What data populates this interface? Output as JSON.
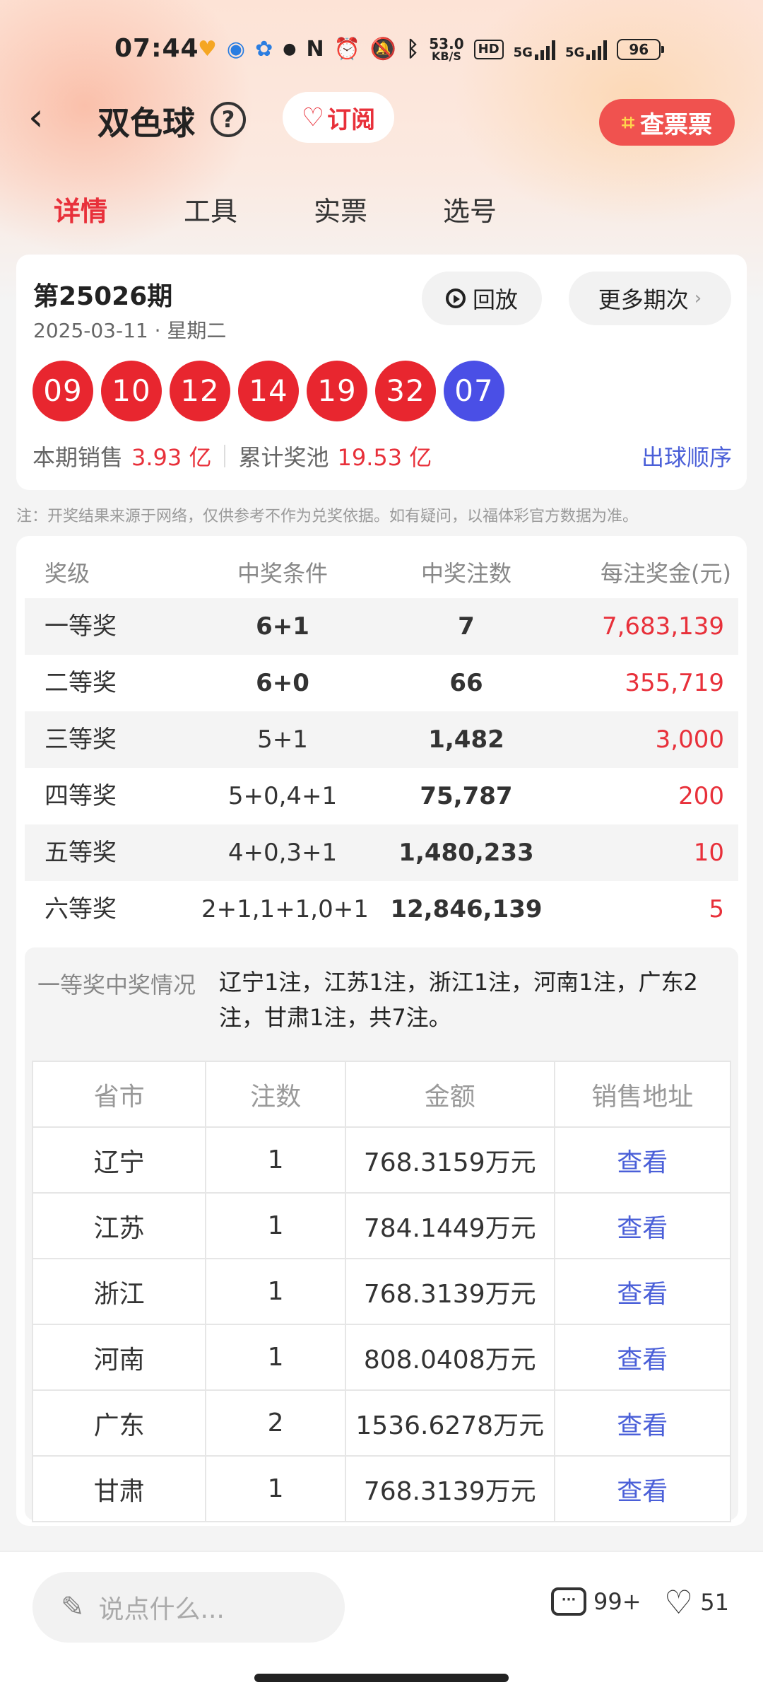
{
  "status_bar": {
    "time": "07:44",
    "net_speed_value": "53.0",
    "net_speed_unit": "KB/S",
    "hd": "HD",
    "signal1": "5G",
    "signal2": "5G",
    "battery": "96"
  },
  "header": {
    "title": "双色球",
    "help": "?",
    "subscribe_label": "订阅",
    "check_ticket_label": "查票票"
  },
  "tabs": [
    {
      "label": "详情",
      "active": true
    },
    {
      "label": "工具",
      "active": false
    },
    {
      "label": "实票",
      "active": false
    },
    {
      "label": "选号",
      "active": false
    }
  ],
  "draw": {
    "issue": "第25026期",
    "date": "2025-03-11 · 星期二",
    "replay_label": "回放",
    "more_label": "更多期次",
    "red_balls": [
      "09",
      "10",
      "12",
      "14",
      "19",
      "32"
    ],
    "blue_ball": "07",
    "sales_label": "本期销售",
    "sales_value": "3.93 亿",
    "pool_label": "累计奖池",
    "pool_value": "19.53 亿",
    "order_label": "出球顺序"
  },
  "note": "注：开奖结果来源于网络，仅供参考不作为兑奖依据。如有疑问，以福体彩官方数据为准。",
  "prize_table": {
    "headers": [
      "奖级",
      "中奖条件",
      "中奖注数",
      "每注奖金(元)"
    ],
    "rows": [
      {
        "level": "一等奖",
        "cond": "6+1",
        "count": "7",
        "amount": "7,683,139"
      },
      {
        "level": "二等奖",
        "cond": "6+0",
        "count": "66",
        "amount": "355,719"
      },
      {
        "level": "三等奖",
        "cond": "5+1",
        "count": "1,482",
        "amount": "3,000"
      },
      {
        "level": "四等奖",
        "cond": "5+0,4+1",
        "count": "75,787",
        "amount": "200"
      },
      {
        "level": "五等奖",
        "cond": "4+0,3+1",
        "count": "1,480,233",
        "amount": "10"
      },
      {
        "level": "六等奖",
        "cond": "2+1,1+1,0+1",
        "count": "12,846,139",
        "amount": "5"
      }
    ]
  },
  "winners": {
    "label": "一等奖中奖情况",
    "summary": "辽宁1注，江苏1注，浙江1注，河南1注，广东2注，甘肃1注，共7注。",
    "headers": [
      "省市",
      "注数",
      "金额",
      "销售地址"
    ],
    "rows": [
      {
        "province": "辽宁",
        "count": "1",
        "amount": "768.3159万元",
        "link": "查看"
      },
      {
        "province": "江苏",
        "count": "1",
        "amount": "784.1449万元",
        "link": "查看"
      },
      {
        "province": "浙江",
        "count": "1",
        "amount": "768.3139万元",
        "link": "查看"
      },
      {
        "province": "河南",
        "count": "1",
        "amount": "808.0408万元",
        "link": "查看"
      },
      {
        "province": "广东",
        "count": "2",
        "amount": "1536.6278万元",
        "link": "查看"
      },
      {
        "province": "甘肃",
        "count": "1",
        "amount": "768.3139万元",
        "link": "查看"
      }
    ]
  },
  "bottom_bar": {
    "comment_placeholder": "说点什么...",
    "comment_count": "99+",
    "like_count": "51"
  },
  "colors": {
    "accent_red": "#e8303a",
    "ball_red": "#e8262f",
    "ball_blue": "#4a4fe6",
    "link_blue": "#4a5fd8"
  }
}
